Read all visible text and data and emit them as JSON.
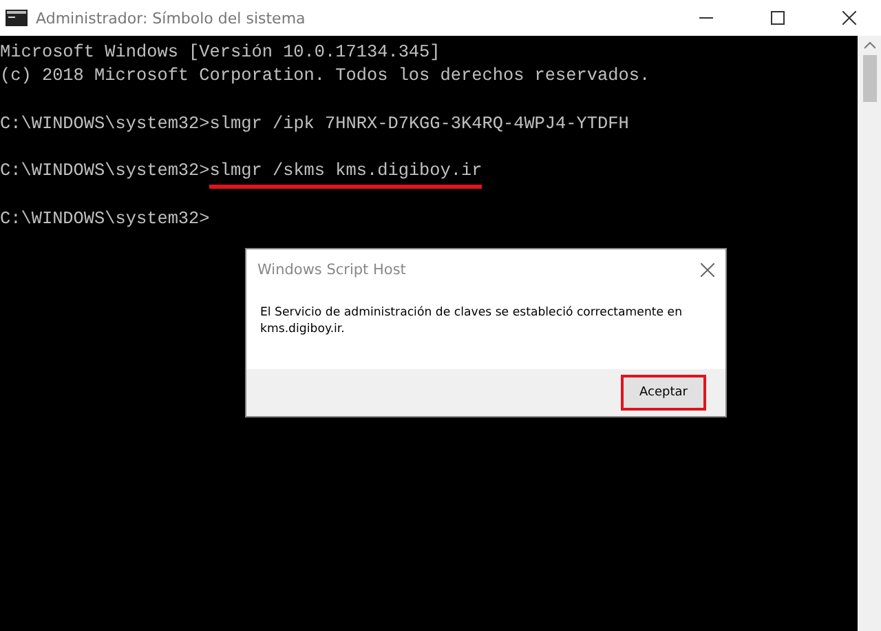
{
  "window": {
    "title": "Administrador: Símbolo del sistema"
  },
  "console": {
    "lines": [
      {
        "kind": "output",
        "text": "Microsoft Windows [Versión 10.0.17134.345]",
        "highlighted": false
      },
      {
        "kind": "output",
        "text": "(c) 2018 Microsoft Corporation. Todos los derechos reservados.",
        "highlighted": false
      },
      {
        "kind": "prompt",
        "prompt": "C:\\WINDOWS\\system32>",
        "text": "slmgr /ipk 7HNRX-D7KGG-3K4RQ-4WPJ4-YTDFH",
        "highlighted": false
      },
      {
        "kind": "prompt",
        "prompt": "C:\\WINDOWS\\system32>",
        "text": "slmgr /skms kms.digiboy.ir",
        "highlighted": true
      },
      {
        "kind": "prompt",
        "prompt": "C:\\WINDOWS\\system32>"
      }
    ]
  },
  "dialog": {
    "title": "Windows Script Host",
    "message": "El Servicio de administración de claves se estableció correctamente en kms.digiboy.ir.",
    "button": {
      "label": "Aceptar",
      "highlighted": true
    }
  }
}
